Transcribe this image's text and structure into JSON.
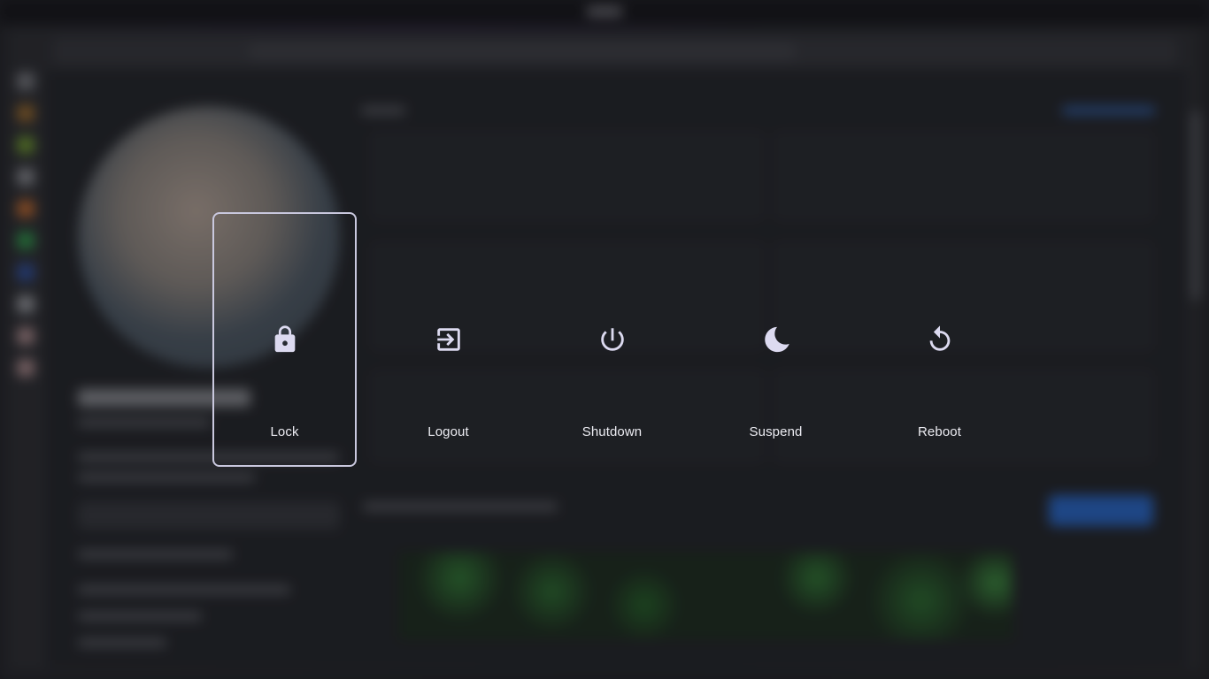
{
  "power_menu": {
    "selected_index": 0,
    "options": [
      {
        "label": "Lock",
        "icon": "lock-icon"
      },
      {
        "label": "Logout",
        "icon": "logout-icon"
      },
      {
        "label": "Shutdown",
        "icon": "power-icon"
      },
      {
        "label": "Suspend",
        "icon": "moon-icon"
      },
      {
        "label": "Reboot",
        "icon": "reboot-icon"
      }
    ]
  },
  "colors": {
    "icon": "#dcdaf0",
    "selected_border": "#c9c8de",
    "label": "#ececf2"
  }
}
